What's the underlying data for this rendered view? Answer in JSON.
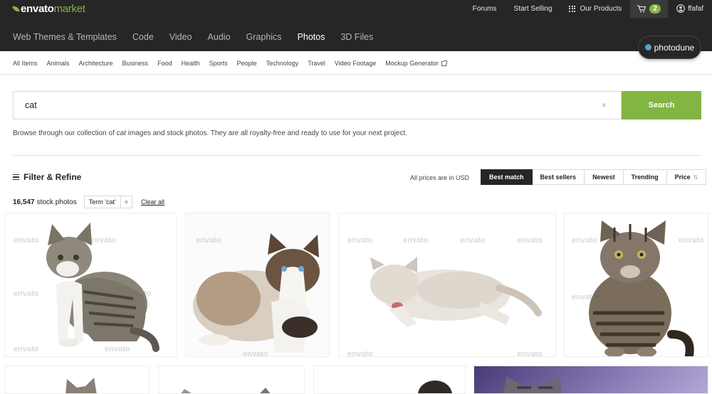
{
  "brand": {
    "name_a": "envato",
    "name_b": "market"
  },
  "header": {
    "links": {
      "forums": "Forums",
      "start_selling": "Start Selling",
      "our_products": "Our Products"
    },
    "cart_count": "2",
    "username": "ffafaf",
    "categories": [
      "Web Themes & Templates",
      "Code",
      "Video",
      "Audio",
      "Graphics",
      "Photos",
      "3D Files"
    ],
    "active_category": "Photos",
    "site_badge": "photodune"
  },
  "subnav": [
    "All Items",
    "Animals",
    "Architecture",
    "Business",
    "Food",
    "Health",
    "Sports",
    "People",
    "Technology",
    "Travel",
    "Video Footage",
    "Mockup Generator"
  ],
  "search": {
    "value": "cat",
    "clear": "×",
    "button": "Search"
  },
  "browse_text": {
    "before": "Browse through our collection of ",
    "term": "cat",
    "after": " images and stock photos. They are all royalty-free and ready to use for your next project."
  },
  "filter": {
    "label": "Filter & Refine",
    "prices_note": "All prices are in USD"
  },
  "sort": {
    "options": [
      "Best match",
      "Best sellers",
      "Newest",
      "Trending",
      "Price"
    ],
    "active": "Best match",
    "price_arrows": "⇅"
  },
  "results": {
    "count": "16,547",
    "count_label": "stock photos",
    "chip": "Term 'cat'",
    "chip_remove": "×",
    "clear_all": "Clear all"
  },
  "watermark": "envato",
  "colors": {
    "brand_green": "#82b541",
    "header_bg": "#262626"
  }
}
